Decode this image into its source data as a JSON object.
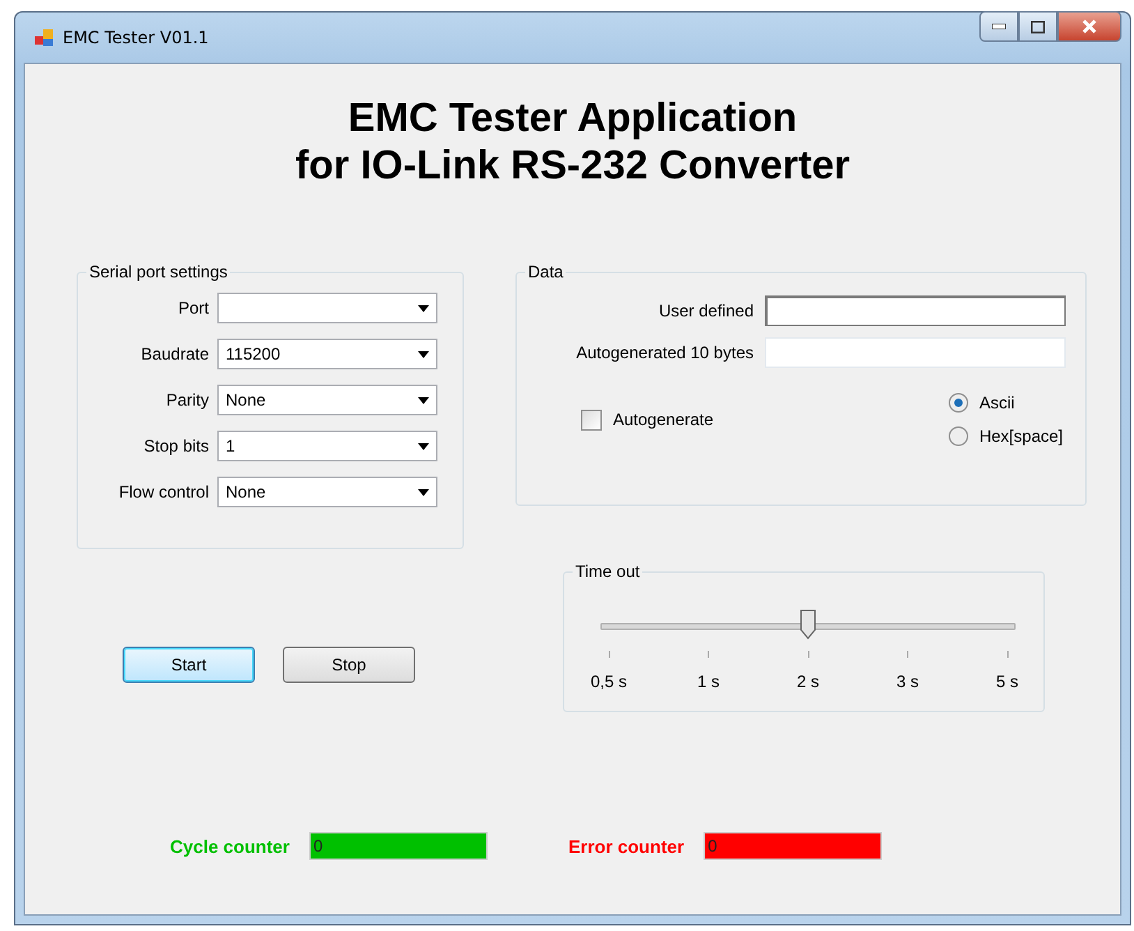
{
  "window": {
    "title": "EMC Tester V01.1"
  },
  "heading": [
    "EMC Tester Application",
    "for IO-Link  RS-232 Converter"
  ],
  "serial_port_settings": {
    "title": "Serial port settings",
    "fields": [
      {
        "label": "Port"
      },
      {
        "label": "Baudrate",
        "value": "115200"
      },
      {
        "label": "Parity",
        "value": "None"
      },
      {
        "label": "Stop bits",
        "value": "1"
      },
      {
        "label": "Flow control",
        "value": "None"
      }
    ]
  },
  "data": {
    "title": "Data",
    "inputs": [
      {
        "label": "User defined",
        "focused": true
      },
      {
        "label": "Autogenerated 10 bytes",
        "focused": false
      }
    ],
    "autogenerate": {
      "label": "Autogenerate",
      "checked": false
    },
    "format": [
      {
        "label": "Ascii",
        "selected": true
      },
      {
        "label": "Hex[space]",
        "selected": false
      }
    ]
  },
  "time_out": {
    "title": "Time out",
    "level": 0.5,
    "ticks": [
      "0,5 s",
      "1 s",
      "2 s",
      "3 s",
      "5 s"
    ]
  },
  "buttons": [
    {
      "label": "Start",
      "focused": true
    },
    {
      "label": "Stop",
      "focused": false
    }
  ],
  "counters": [
    {
      "label": "Cycle counter",
      "value": "0",
      "color": "#00c000"
    },
    {
      "label": "Error counter",
      "value": "0",
      "color": "#ff0000"
    }
  ]
}
